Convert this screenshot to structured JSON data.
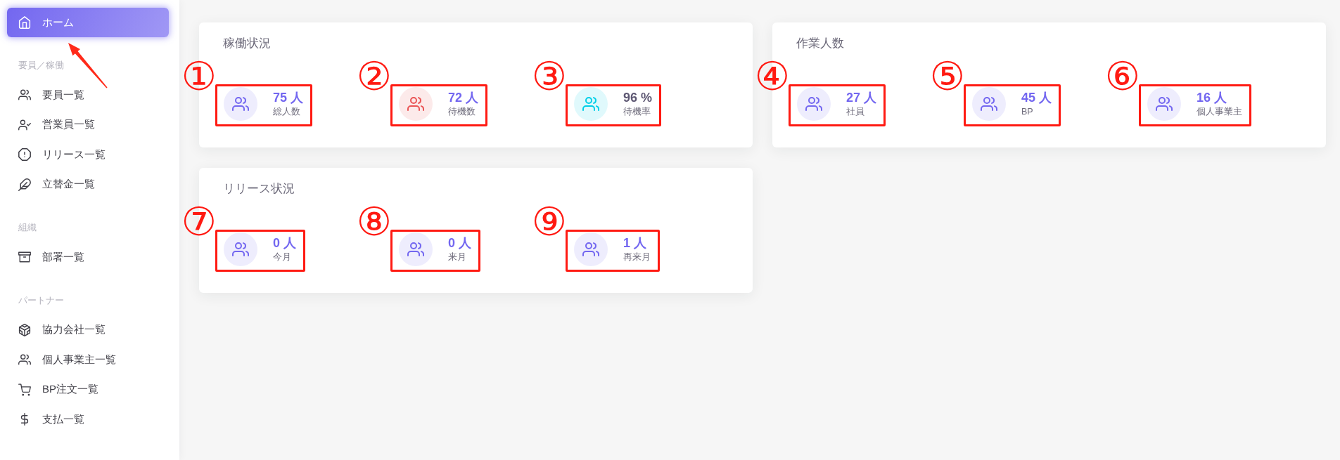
{
  "sidebar": {
    "home": {
      "label": "ホーム",
      "selected": true,
      "arrow": true
    },
    "sections": [
      {
        "title": "要員／稼働",
        "items": [
          {
            "label": "要員一覧",
            "selected": false
          },
          {
            "label": "営業員一覧",
            "selected": false
          },
          {
            "label": "リリース一覧",
            "selected": false
          },
          {
            "label": "立替金一覧",
            "selected": false
          }
        ]
      },
      {
        "title": "組織",
        "items": [
          {
            "label": "部署一覧",
            "selected": false
          }
        ]
      },
      {
        "title": "パートナー",
        "items": [
          {
            "label": "協力会社一覧",
            "selected": false
          },
          {
            "label": "個人事業主一覧",
            "selected": false
          },
          {
            "label": "BP注文一覧",
            "selected": false
          },
          {
            "label": "支払一覧",
            "selected": false
          }
        ]
      }
    ]
  },
  "cards": [
    {
      "title": "稼働状況",
      "stats": [
        {
          "value": "75 人",
          "label": "総人数",
          "color": "#7367f0",
          "kind": "count",
          "annotation": "①"
        },
        {
          "value": "72 人",
          "label": "待機数",
          "color": "#ea5455",
          "kind": "count",
          "annotation": "②"
        },
        {
          "value": "96 %",
          "label": "待機率",
          "color": "#00cfe8",
          "kind": "rate",
          "annotation": "③"
        }
      ]
    },
    {
      "title": "作業人数",
      "stats": [
        {
          "value": "27 人",
          "label": "社員",
          "color": "#7367f0",
          "kind": "count",
          "annotation": "④"
        },
        {
          "value": "45 人",
          "label": "BP",
          "color": "#7367f0",
          "kind": "count",
          "annotation": "⑤"
        },
        {
          "value": "16 人",
          "label": "個人事業主",
          "color": "#7367f0",
          "kind": "count",
          "annotation": "⑥"
        }
      ]
    },
    {
      "title": "リリース状況",
      "stats": [
        {
          "value": "0 人",
          "label": "今月",
          "color": "#7367f0",
          "kind": "count",
          "annotation": "⑦"
        },
        {
          "value": "0 人",
          "label": "来月",
          "color": "#7367f0",
          "kind": "count",
          "annotation": "⑧"
        },
        {
          "value": "1 人",
          "label": "再来月",
          "color": "#7367f0",
          "kind": "count",
          "annotation": "⑨"
        }
      ]
    }
  ]
}
